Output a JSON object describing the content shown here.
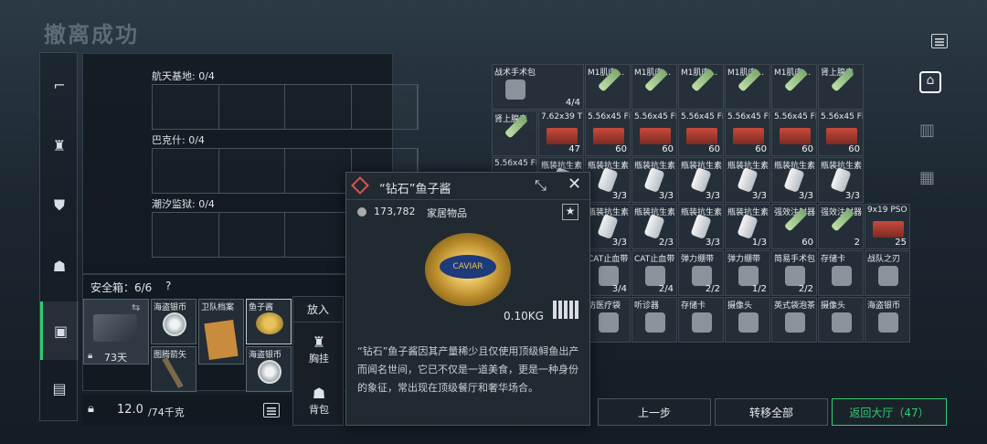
{
  "page": {
    "title": "撤离成功"
  },
  "tasks": [
    {
      "label": "航天基地: 0/4"
    },
    {
      "label": "巴克什: 0/4"
    },
    {
      "label": "潮汐监狱: 0/4"
    }
  ],
  "safebox": {
    "label": "安全箱：6/6",
    "help": "?",
    "days": "73天",
    "items": [
      {
        "name": "海盗银币"
      },
      {
        "name": "卫队档案"
      },
      {
        "name": "鱼子酱"
      },
      {
        "name": "图腾箭矢"
      },
      {
        "name": "海盗银币"
      }
    ],
    "put_label": "放入",
    "chest_label": "胸挂",
    "backpack_label": "背包"
  },
  "weight": {
    "value": "12.0",
    "max": "/74千克"
  },
  "popup": {
    "title": "“钻石”鱼子酱",
    "price": "173,782",
    "category": "家居物品",
    "weight": "0.10KG",
    "description": "“钻石”鱼子酱因其产量稀少且仅使用顶级鲟鱼出产而闻名世间，它已不仅是一道美食，更是一种身份的象征，常出现在顶级餐厅和奢华场合。",
    "can_label": "CAVIAR"
  },
  "inventory": {
    "rows": [
      [
        {
          "name": "战术手术包",
          "count": "4/4"
        },
        {
          "name": "M1肌肉...",
          "count": ""
        },
        {
          "name": "M1肌肉...",
          "count": ""
        },
        {
          "name": "M1肌肉...",
          "count": ""
        },
        {
          "name": "M1肌肉...",
          "count": ""
        },
        {
          "name": "M1肌肉...",
          "count": ""
        },
        {
          "name": "肾上腺素",
          "count": ""
        }
      ],
      [
        {
          "name": "肾上腺素",
          "count": ""
        },
        {
          "name": "7.62x39 T",
          "count": "47"
        },
        {
          "name": "5.56x45 FMJ",
          "count": "60"
        },
        {
          "name": "5.56x45 FMJ",
          "count": "60"
        },
        {
          "name": "5.56x45 FMJ",
          "count": "60"
        },
        {
          "name": "5.56x45 FMJ",
          "count": "60"
        },
        {
          "name": "5.56x45 FMJ",
          "count": "60"
        },
        {
          "name": "5.56x45 FMJ",
          "count": "60"
        }
      ],
      [
        {
          "name": "5.56x45 FMJ",
          "count": ""
        },
        {
          "name": "瓶装抗生素",
          "count": ""
        },
        {
          "name": "瓶装抗生素",
          "count": "3/3"
        },
        {
          "name": "瓶装抗生素",
          "count": "3/3"
        },
        {
          "name": "瓶装抗生素",
          "count": "3/3"
        },
        {
          "name": "瓶装抗生素",
          "count": "3/3"
        },
        {
          "name": "瓶装抗生素",
          "count": "3/3"
        },
        {
          "name": "瓶装抗生素",
          "count": "3/3"
        }
      ],
      [
        {
          "name": "瓶装抗生素",
          "count": "3/3"
        },
        {
          "name": "瓶装抗生素",
          "count": "2/3"
        },
        {
          "name": "瓶装抗生素",
          "count": "3/3"
        },
        {
          "name": "瓶装抗生素",
          "count": "1/3"
        },
        {
          "name": "强效注射器",
          "count": "60"
        },
        {
          "name": "强效注射器",
          "count": "2"
        },
        {
          "name": "9x19 PSO",
          "count": "25"
        }
      ],
      [
        {
          "name": "CAT止血带",
          "count": "3/4"
        },
        {
          "name": "CAT止血带",
          "count": "2/4"
        },
        {
          "name": "弹力绷带",
          "count": "2/2"
        },
        {
          "name": "弹力绷带",
          "count": "1/2"
        },
        {
          "name": "简易手术包",
          "count": "2/2"
        },
        {
          "name": "存储卡",
          "count": ""
        },
        {
          "name": "战队之刃",
          "count": ""
        }
      ],
      [
        {
          "name": "防医疗袋",
          "count": ""
        },
        {
          "name": "听诊器",
          "count": ""
        },
        {
          "name": "存储卡",
          "count": ""
        },
        {
          "name": "摄像头",
          "count": ""
        },
        {
          "name": "英式袋泡茶",
          "count": ""
        },
        {
          "name": "摄像头",
          "count": ""
        },
        {
          "name": "海盗银币",
          "count": ""
        }
      ]
    ]
  },
  "buttons": {
    "prev": "上一步",
    "transfer_all": "转移全部",
    "return_lobby": "返回大厅（47）"
  },
  "colors": {
    "accent": "#2ecc71",
    "popup_bg": "#222a31",
    "diamond": "#e05050"
  }
}
